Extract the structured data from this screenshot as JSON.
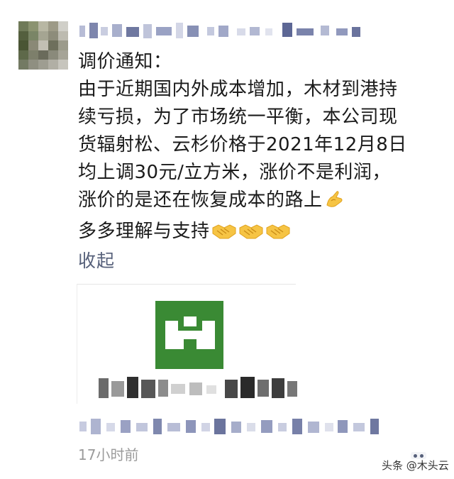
{
  "post": {
    "lines": [
      "调价通知：",
      "由于近期国内外成本增加，木材到港持",
      "续亏损，为了市场统一平衡，本公司现",
      "货辐射松、云杉价格于2021年12月8日",
      "均上调30元/立方米，涨价不是利润，",
      "涨价的是还在恢复成本的路上",
      "多多理解与支持"
    ],
    "line5_emoji": "ok-hand-emoji",
    "line6_emoji": "handshake-emoji",
    "collapse_label": "收起"
  },
  "footer": {
    "timestamp": "17小时前",
    "watermark": "头条 @木头云"
  },
  "icons": {
    "more": "more-dots-icon"
  },
  "colors": {
    "link_text": "#56607a",
    "timestamp": "#9b9b9b",
    "card_thumb": "#3a8a34"
  }
}
